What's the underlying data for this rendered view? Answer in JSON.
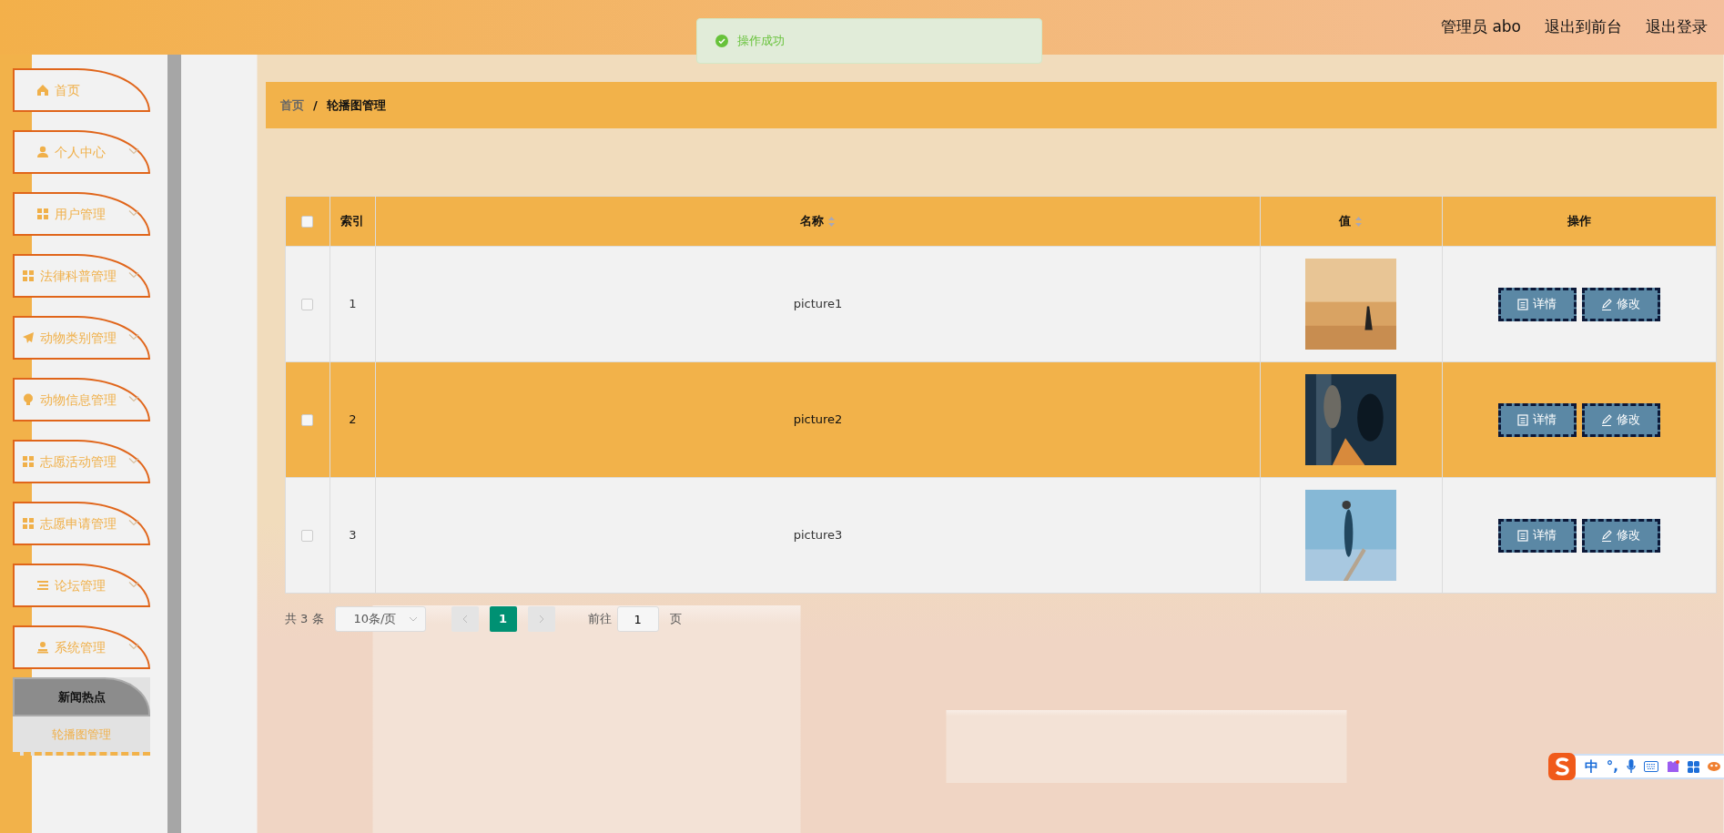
{
  "header": {
    "user": "管理员 abo",
    "links": [
      "退出到前台",
      "退出登录"
    ]
  },
  "toast": {
    "text": "操作成功"
  },
  "sidebar": {
    "items": [
      {
        "label": "首页",
        "expandable": false
      },
      {
        "label": "个人中心",
        "expandable": true
      },
      {
        "label": "用户管理",
        "expandable": true
      },
      {
        "label": "法律科普管理",
        "expandable": true
      },
      {
        "label": "动物类别管理",
        "expandable": true
      },
      {
        "label": "动物信息管理",
        "expandable": true
      },
      {
        "label": "志愿活动管理",
        "expandable": true
      },
      {
        "label": "志愿申请管理",
        "expandable": true
      },
      {
        "label": "论坛管理",
        "expandable": true
      },
      {
        "label": "系统管理",
        "expandable": true,
        "children": [
          {
            "label": "新闻热点",
            "highlighted": true
          },
          {
            "label": "轮播图管理",
            "highlighted": false
          }
        ]
      }
    ]
  },
  "breadcrumb": [
    "首页",
    "/",
    "轮播图管理"
  ],
  "table": {
    "select_all": {
      "checked": false
    },
    "columns": [
      {
        "label": "索引",
        "sortable": false
      },
      {
        "label": "名称",
        "sortable": true
      },
      {
        "label": "值",
        "sortable": true
      },
      {
        "label": "操作",
        "sortable": false
      }
    ],
    "rows": [
      {
        "index": "1",
        "name": "picture1",
        "checked": false,
        "selected": false,
        "actions": [
          "详情",
          "修改"
        ]
      },
      {
        "index": "2",
        "name": "picture2",
        "checked": false,
        "selected": true,
        "actions": [
          "详情",
          "修改"
        ]
      },
      {
        "index": "3",
        "name": "picture3",
        "checked": false,
        "selected": false,
        "actions": [
          "详情",
          "修改"
        ]
      }
    ]
  },
  "pagination": {
    "total": "共 3 条",
    "page_size": "10条/页",
    "pages": [
      {
        "label": "1",
        "selected": true
      }
    ],
    "goto_label": "前往",
    "goto_value": "1",
    "goto_unit": "页"
  },
  "ime_toolbar": {
    "mode": "中",
    "punctuation": "°,"
  }
}
